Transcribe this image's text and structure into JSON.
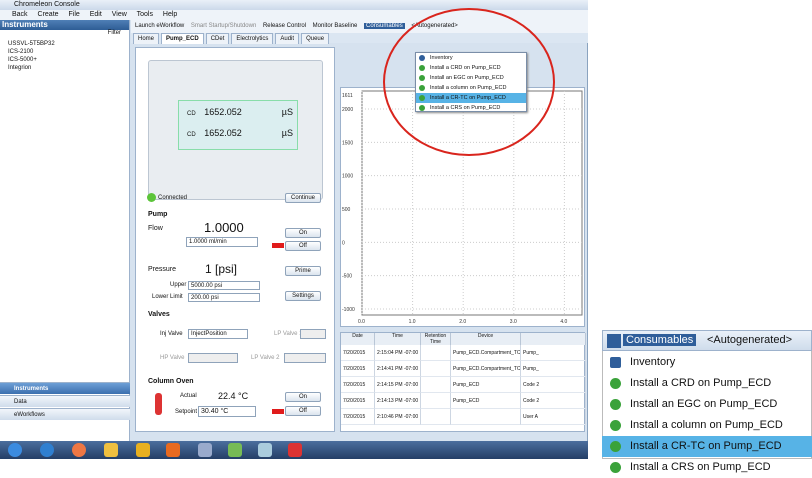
{
  "window": {
    "title": "Chromeleon Console"
  },
  "menu": {
    "back": "Back",
    "create": "Create",
    "file": "File",
    "edit": "Edit",
    "view": "View",
    "tools": "Tools",
    "help": "Help"
  },
  "left": {
    "header": "Instruments",
    "filter": "Filter",
    "tree": [
      "USSVL-5T5BP32",
      "ICS-2100",
      "ICS-5000+",
      "Integrion"
    ],
    "nav": [
      "Instruments",
      "Data",
      "eWorkflows"
    ]
  },
  "toolbar": {
    "launch": "Launch eWorkflow",
    "smart": "Smart Startup/Shutdown",
    "release": "Release Control",
    "monitor": "Monitor Baseline",
    "consumables": "Consumables",
    "autogen": "<Autogenerated>"
  },
  "tabs": [
    "Home",
    "Pump_ECD",
    "CDet",
    "Electrolytics",
    "Audit",
    "Queue"
  ],
  "detector": {
    "row1_label": "CD",
    "row1_value": "1652.052",
    "row1_unit": "µS",
    "row2_label": "CD",
    "row2_value": "1652.052",
    "row2_unit": "µS",
    "connected": "Connected",
    "continue": "Continue"
  },
  "pump": {
    "title": "Pump",
    "flow_label": "Flow",
    "flow_value": "1.0000",
    "flow_input": "1.0000 ml/min",
    "on": "On",
    "off": "Off",
    "pressure_label": "Pressure",
    "pressure_value": "1 [psi]",
    "prime": "Prime",
    "upper_label": "Upper",
    "upper_value": "5000.00 psi",
    "lower_label": "Lower Limit",
    "lower_value": "200.00 psi",
    "settings": "Settings"
  },
  "valves": {
    "title": "Valves",
    "inj_label": "Inj Valve",
    "inj_value": "InjectPosition",
    "lp1": "LP Valve 1",
    "hp": "HP Valve",
    "lp2": "LP Valve 2"
  },
  "oven": {
    "title": "Column Oven",
    "actual_label": "Actual",
    "actual_value": "22.4 °C",
    "setpoint_label": "Setpoint",
    "setpoint_value": "30.40 °C",
    "on": "On",
    "off": "Off"
  },
  "chart_data": {
    "type": "line",
    "yticks": [
      "2000",
      "1500",
      "1000",
      "500",
      "0",
      "-500",
      "-1000"
    ],
    "ytop": "1611",
    "xticks": [
      "0.0",
      "1.0",
      "2.0",
      "3.0",
      "4.0"
    ],
    "series": []
  },
  "table": {
    "headers": [
      "Date",
      "Time",
      "Retention Time",
      "Device",
      ""
    ],
    "rows": [
      [
        "7/20/2015",
        "2:15:04 PM -07:00",
        "",
        "Pump_ECD.Compartment_TC",
        "Pump_"
      ],
      [
        "7/20/2015",
        "2:14:41 PM -07:00",
        "",
        "Pump_ECD.Compartment_TC",
        "Pump_"
      ],
      [
        "7/20/2015",
        "2:14:15 PM -07:00",
        "",
        "Pump_ECD",
        "Code 2"
      ],
      [
        "7/20/2015",
        "2:14:13 PM -07:00",
        "",
        "Pump_ECD",
        "Code 2"
      ],
      [
        "7/20/2015",
        "2:10:46 PM -07:00",
        "",
        "",
        "User A"
      ]
    ]
  },
  "dropdown": {
    "items": [
      "Inventory",
      "Install a CRD on Pump_ECD",
      "Install an EGC on Pump_ECD",
      "Install a column on Pump_ECD",
      "Install a CR-TC on Pump_ECD",
      "Install a CRS on Pump_ECD"
    ],
    "highlighted": 4
  },
  "zoom": {
    "consumables": "Consumables",
    "autogen": "<Autogenerated>",
    "items": [
      "Inventory",
      "Install a CRD on Pump_ECD",
      "Install an EGC on Pump_ECD",
      "Install a column on Pump_ECD",
      "Install a CR-TC on Pump_ECD",
      "Install a CRS on Pump_ECD"
    ]
  },
  "colors": {
    "accent": "#2f5e9a",
    "highlight": "#57b3e6",
    "ring": "#d9251d",
    "off": "#e01b1b"
  }
}
